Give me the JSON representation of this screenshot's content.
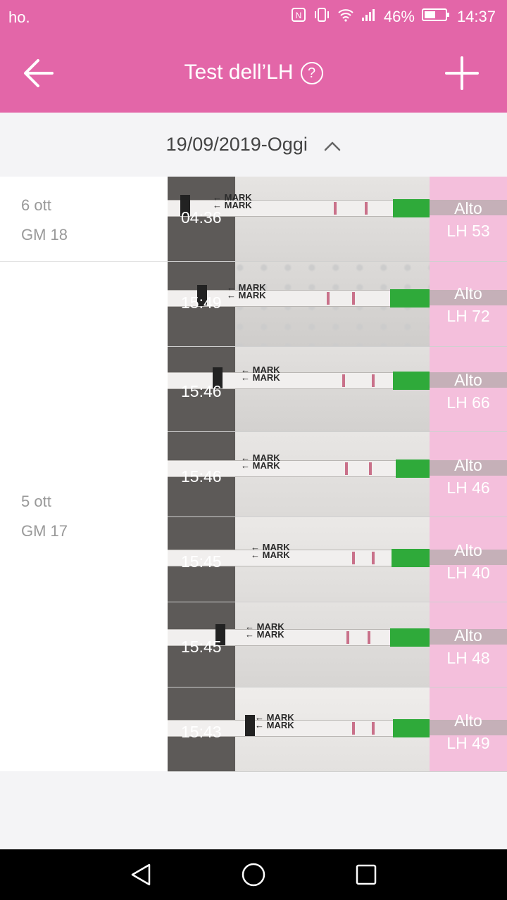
{
  "status": {
    "carrier": "ho.",
    "battery": "46%",
    "time": "14:37"
  },
  "header": {
    "title": "Test dell’LH",
    "help_symbol": "?"
  },
  "range": {
    "label": "19/09/2019-Oggi"
  },
  "days": [
    {
      "date": "6 ott",
      "cycle_day": "GM 18"
    },
    {
      "date": "5 ott",
      "cycle_day": "GM 17"
    }
  ],
  "strip_text": "MARK",
  "tests": [
    {
      "time": "04:36",
      "result": "Alto",
      "lh": "LH 53"
    },
    {
      "time": "15:49",
      "result": "Alto",
      "lh": "LH 72"
    },
    {
      "time": "15:46",
      "result": "Alto",
      "lh": "LH 66"
    },
    {
      "time": "15:46",
      "result": "Alto",
      "lh": "LH 46"
    },
    {
      "time": "15:45",
      "result": "Alto",
      "lh": "LH 40"
    },
    {
      "time": "15:45",
      "result": "Alto",
      "lh": "LH 48"
    },
    {
      "time": "15:43",
      "result": "Alto",
      "lh": "LH 49"
    }
  ],
  "colors": {
    "header": "#e366a8",
    "result_bg": "#f4bfdc",
    "control_green": "#2faa3a"
  },
  "icons": {
    "back": "arrow-left-icon",
    "help": "help-circle-icon",
    "add": "plus-icon",
    "range": "chevron-up-icon"
  }
}
